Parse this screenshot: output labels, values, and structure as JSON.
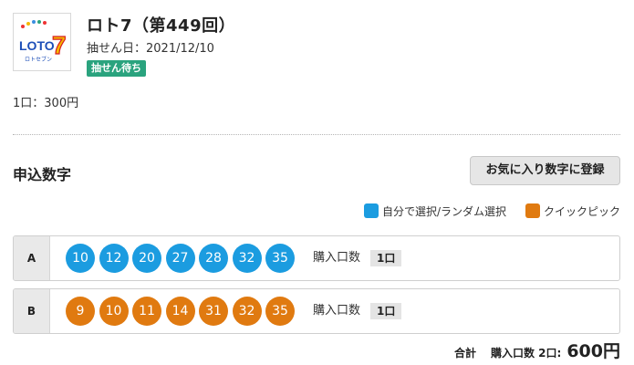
{
  "lottery": {
    "logo_text": "LOTO7",
    "logo_sub": "ロトセブン",
    "title": "ロト7（第449回）",
    "draw_date": "抽せん日：2021/12/10",
    "status": "抽せん待ち",
    "price": "1口：300円"
  },
  "section": {
    "title": "申込数字",
    "favorite_button": "お気に入り数字に登録"
  },
  "legend": {
    "self_label": "自分で選択/ランダム選択",
    "self_color": "#1b9ce0",
    "quick_label": "クイックピック",
    "quick_color": "#e07a10"
  },
  "rows": [
    {
      "label": "A",
      "type": "self",
      "numbers": [
        "10",
        "12",
        "20",
        "27",
        "28",
        "32",
        "35"
      ],
      "qty_label": "購入口数",
      "qty": "1口"
    },
    {
      "label": "B",
      "type": "quick",
      "numbers": [
        "9",
        "10",
        "11",
        "14",
        "31",
        "32",
        "35"
      ],
      "qty_label": "購入口数",
      "qty": "1口"
    }
  ],
  "total": {
    "label": "合計",
    "qty_text": "購入口数 2口:",
    "amount": "600円"
  }
}
